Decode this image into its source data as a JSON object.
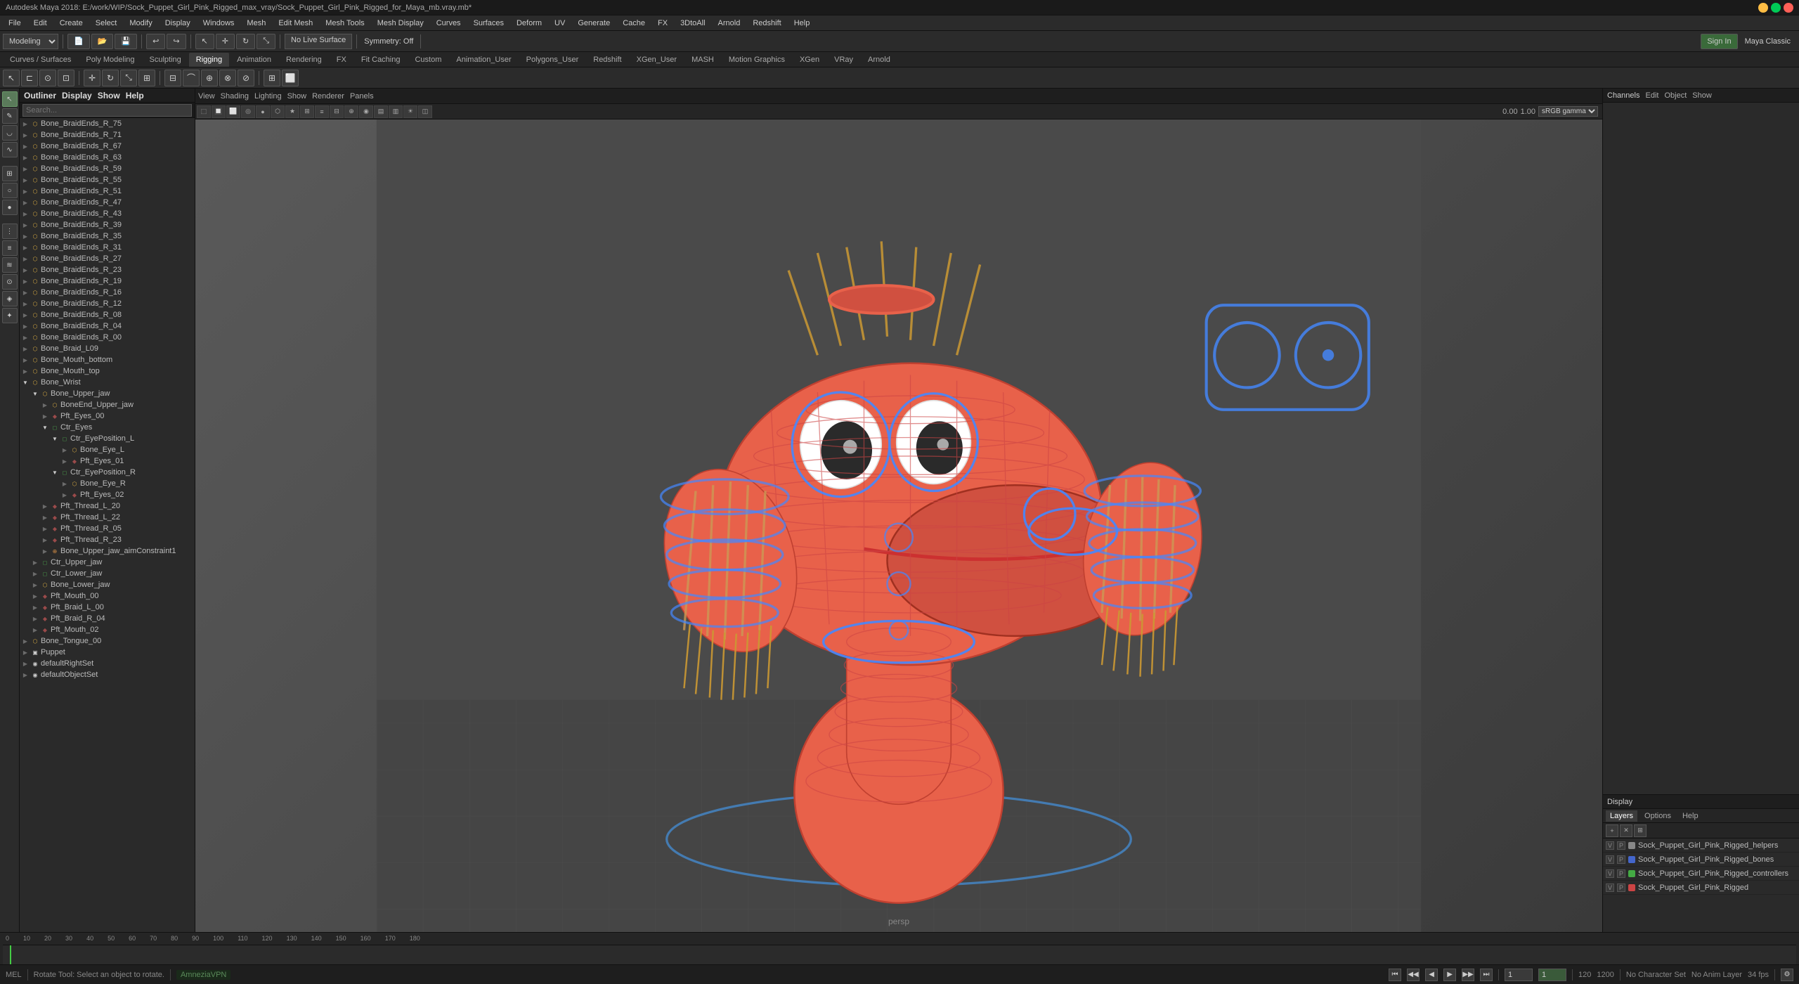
{
  "app": {
    "title": "Autodesk Maya 2018: E:/work/WIP/Sock_Puppet_Girl_Pink_Rigged_max_vray/Sock_Puppet_Girl_Pink_Rigged_for_Maya_mb.vray.mb*",
    "workspace": "Maya Classic"
  },
  "menu": {
    "items": [
      "File",
      "Edit",
      "Create",
      "Select",
      "Modify",
      "Display",
      "Windows",
      "Mesh",
      "Edit Mesh",
      "Mesh Tools",
      "Mesh Display",
      "Curves",
      "Surfaces",
      "Deform",
      "UV",
      "Generate",
      "Cache",
      "FX",
      "3DtoAll",
      "Arnold",
      "Redshift",
      "Help"
    ]
  },
  "toolbar1": {
    "mode_select": "Modeling",
    "no_live_surface": "No Live Surface",
    "symmetry": "Symmetry: Off",
    "sign_in": "Sign In"
  },
  "tabs": {
    "items": [
      "Curves / Surfaces",
      "Poly Modeling",
      "Sculpting",
      "Rigging",
      "Animation",
      "Rendering",
      "FX",
      "Fit Caching",
      "Custom",
      "Animation_User",
      "Polygons_User",
      "Redshift",
      "XGen_User",
      "MASH",
      "Motion Graphics",
      "XGen",
      "VRay",
      "Arnold"
    ]
  },
  "viewport": {
    "menus": [
      "View",
      "Shading",
      "Lighting",
      "Show",
      "Renderer",
      "Panels"
    ],
    "persp_label": "persp",
    "gamma_label": "sRGB gamma",
    "gamma_value": "1.00",
    "camera_value": "0.00"
  },
  "outliner": {
    "title": "Outliner",
    "menus": [
      "Display",
      "Show",
      "Help"
    ],
    "search_placeholder": "Search...",
    "items": [
      {
        "label": "Bone_BraidEnds_R_75",
        "indent": 0,
        "icon": "bone",
        "expanded": false
      },
      {
        "label": "Bone_BraidEnds_R_71",
        "indent": 0,
        "icon": "bone",
        "expanded": false
      },
      {
        "label": "Bone_BraidEnds_R_67",
        "indent": 0,
        "icon": "bone",
        "expanded": false
      },
      {
        "label": "Bone_BraidEnds_R_63",
        "indent": 0,
        "icon": "bone",
        "expanded": false
      },
      {
        "label": "Bone_BraidEnds_R_59",
        "indent": 0,
        "icon": "bone",
        "expanded": false
      },
      {
        "label": "Bone_BraidEnds_R_55",
        "indent": 0,
        "icon": "bone",
        "expanded": false
      },
      {
        "label": "Bone_BraidEnds_R_51",
        "indent": 0,
        "icon": "bone",
        "expanded": false
      },
      {
        "label": "Bone_BraidEnds_R_47",
        "indent": 0,
        "icon": "bone",
        "expanded": false
      },
      {
        "label": "Bone_BraidEnds_R_43",
        "indent": 0,
        "icon": "bone",
        "expanded": false
      },
      {
        "label": "Bone_BraidEnds_R_39",
        "indent": 0,
        "icon": "bone",
        "expanded": false
      },
      {
        "label": "Bone_BraidEnds_R_35",
        "indent": 0,
        "icon": "bone",
        "expanded": false
      },
      {
        "label": "Bone_BraidEnds_R_31",
        "indent": 0,
        "icon": "bone",
        "expanded": false
      },
      {
        "label": "Bone_BraidEnds_R_27",
        "indent": 0,
        "icon": "bone",
        "expanded": false
      },
      {
        "label": "Bone_BraidEnds_R_23",
        "indent": 0,
        "icon": "bone",
        "expanded": false
      },
      {
        "label": "Bone_BraidEnds_R_19",
        "indent": 0,
        "icon": "bone",
        "expanded": false
      },
      {
        "label": "Bone_BraidEnds_R_16",
        "indent": 0,
        "icon": "bone",
        "expanded": false
      },
      {
        "label": "Bone_BraidEnds_R_12",
        "indent": 0,
        "icon": "bone",
        "expanded": false
      },
      {
        "label": "Bone_BraidEnds_R_08",
        "indent": 0,
        "icon": "bone",
        "expanded": false
      },
      {
        "label": "Bone_BraidEnds_R_04",
        "indent": 0,
        "icon": "bone",
        "expanded": false
      },
      {
        "label": "Bone_BraidEnds_R_00",
        "indent": 0,
        "icon": "bone",
        "expanded": false
      },
      {
        "label": "Bone_Braid_L09",
        "indent": 0,
        "icon": "bone",
        "expanded": false
      },
      {
        "label": "Bone_Mouth_bottom",
        "indent": 0,
        "icon": "bone",
        "expanded": false
      },
      {
        "label": "Bone_Mouth_top",
        "indent": 0,
        "icon": "bone",
        "expanded": false
      },
      {
        "label": "Bone_Wrist",
        "indent": 0,
        "icon": "bone",
        "expanded": true
      },
      {
        "label": "Bone_Upper_jaw",
        "indent": 1,
        "icon": "bone",
        "expanded": true
      },
      {
        "label": "BoneEnd_Upper_jaw",
        "indent": 2,
        "icon": "bone",
        "expanded": false
      },
      {
        "label": "Pft_Eyes_00",
        "indent": 2,
        "icon": "joint",
        "expanded": false
      },
      {
        "label": "Ctr_Eyes",
        "indent": 2,
        "icon": "ctrl",
        "expanded": true
      },
      {
        "label": "Ctr_EyePosition_L",
        "indent": 3,
        "icon": "ctrl",
        "expanded": true
      },
      {
        "label": "Bone_Eye_L",
        "indent": 4,
        "icon": "bone",
        "expanded": false
      },
      {
        "label": "Pft_Eyes_01",
        "indent": 4,
        "icon": "joint",
        "expanded": false
      },
      {
        "label": "Ctr_EyePosition_R",
        "indent": 3,
        "icon": "ctrl",
        "expanded": true
      },
      {
        "label": "Bone_Eye_R",
        "indent": 4,
        "icon": "bone",
        "expanded": false
      },
      {
        "label": "Pft_Eyes_02",
        "indent": 4,
        "icon": "joint",
        "expanded": false
      },
      {
        "label": "Pft_Thread_L_20",
        "indent": 2,
        "icon": "joint",
        "expanded": false
      },
      {
        "label": "Pft_Thread_L_22",
        "indent": 2,
        "icon": "joint",
        "expanded": false
      },
      {
        "label": "Pft_Thread_R_05",
        "indent": 2,
        "icon": "joint",
        "expanded": false
      },
      {
        "label": "Pft_Thread_R_23",
        "indent": 2,
        "icon": "joint",
        "expanded": false
      },
      {
        "label": "Bone_Upper_jaw_aimConstraint1",
        "indent": 2,
        "icon": "constraint",
        "expanded": false
      },
      {
        "label": "Ctr_Upper_jaw",
        "indent": 1,
        "icon": "ctrl",
        "expanded": false
      },
      {
        "label": "Ctr_Lower_jaw",
        "indent": 1,
        "icon": "ctrl",
        "expanded": false
      },
      {
        "label": "Bone_Lower_jaw",
        "indent": 1,
        "icon": "bone",
        "expanded": false
      },
      {
        "label": "Pft_Mouth_00",
        "indent": 1,
        "icon": "joint",
        "expanded": false
      },
      {
        "label": "Pft_Braid_L_00",
        "indent": 1,
        "icon": "joint",
        "expanded": false
      },
      {
        "label": "Pft_Braid_R_04",
        "indent": 1,
        "icon": "joint",
        "expanded": false
      },
      {
        "label": "Pft_Mouth_02",
        "indent": 1,
        "icon": "joint",
        "expanded": false
      },
      {
        "label": "Bone_Tongue_00",
        "indent": 0,
        "icon": "bone",
        "expanded": false
      },
      {
        "label": "Puppet",
        "indent": 0,
        "icon": "mesh",
        "expanded": false
      },
      {
        "label": "defaultRightSet",
        "indent": 0,
        "icon": "set",
        "expanded": false
      },
      {
        "label": "defaultObjectSet",
        "indent": 0,
        "icon": "set",
        "expanded": false
      }
    ]
  },
  "channels": {
    "title": "Channels",
    "header_btns": [
      "Edit",
      "Object",
      "Show"
    ]
  },
  "layers": {
    "title": "Display",
    "tabs": [
      "Layers",
      "Options",
      "Help"
    ],
    "items": [
      {
        "name": "Sock_Puppet_Girl_Pink_Rigged_helpers",
        "color": "#888888",
        "visible": true,
        "render": false
      },
      {
        "name": "Sock_Puppet_Girl_Pink_Rigged_bones",
        "color": "#4466cc",
        "visible": true,
        "render": false
      },
      {
        "name": "Sock_Puppet_Girl_Pink_Rigged_controllers",
        "color": "#44aa44",
        "visible": true,
        "render": false
      },
      {
        "name": "Sock_Puppet_Girl_Pink_Rigged",
        "color": "#cc4444",
        "visible": true,
        "render": false
      }
    ]
  },
  "status_bar": {
    "left_label": "MEL",
    "help_text": "Rotate Tool: Select an object to rotate.",
    "no_character_set": "No Character Set",
    "no_anim_layer": "No Anim Layer",
    "fps": "34 fps",
    "network_label": "AmneziaVPN"
  },
  "timeline": {
    "start": 0,
    "end": 120,
    "current": 1,
    "ticks": [
      "0",
      "10",
      "20",
      "30",
      "40",
      "50",
      "60",
      "70",
      "80",
      "90",
      "100",
      "110",
      "120",
      "130",
      "140",
      "150",
      "160",
      "170",
      "180"
    ]
  },
  "anim_controls": {
    "start_frame": "1",
    "current_frame": "1",
    "end_frame": "120",
    "buttons": [
      "⏮",
      "◀◀",
      "◀",
      "▶",
      "▶▶",
      "⏭"
    ]
  },
  "icons": {
    "expand_open": "▼",
    "expand_closed": "▶",
    "bone": "⬡",
    "joint": "◆",
    "ctrl": "◻",
    "mesh": "▣",
    "set": "◉",
    "constraint": "⊕"
  }
}
